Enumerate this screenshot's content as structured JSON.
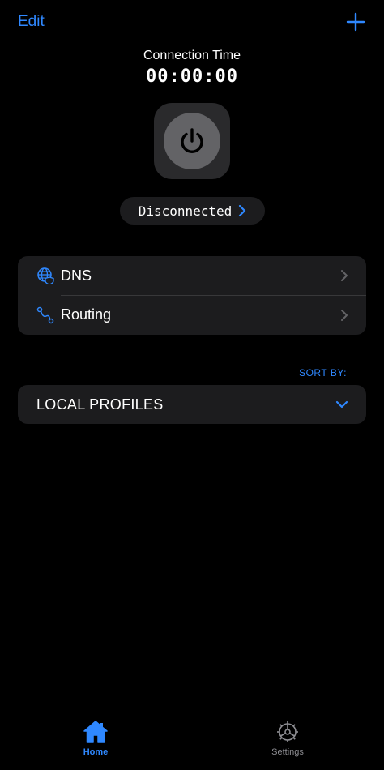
{
  "header": {
    "edit_label": "Edit",
    "add_icon": "plus-icon"
  },
  "connection": {
    "title": "Connection Time",
    "timer": "00:00:00",
    "power_icon": "power-icon",
    "status": "Disconnected"
  },
  "menu": {
    "items": [
      {
        "label": "DNS",
        "icon": "globe-shield-icon"
      },
      {
        "label": "Routing",
        "icon": "route-icon"
      }
    ]
  },
  "sort": {
    "label": "SORT BY:"
  },
  "profiles": {
    "label": "LOCAL PROFILES"
  },
  "tabbar": {
    "tabs": [
      {
        "label": "Home",
        "icon": "house-icon",
        "active": true
      },
      {
        "label": "Settings",
        "icon": "gear-icon",
        "active": false
      }
    ]
  },
  "colors": {
    "accent": "#2f88ff",
    "background": "#000000",
    "card": "#1c1c1e",
    "inactive": "#8e8e93"
  }
}
